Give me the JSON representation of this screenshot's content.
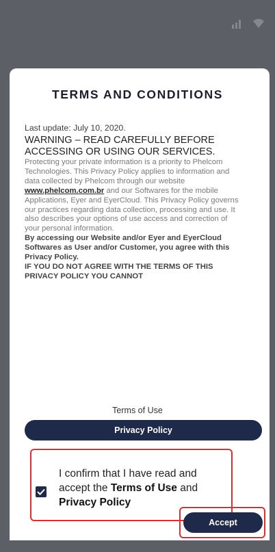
{
  "dialog": {
    "title": "TERMS AND CONDITIONS",
    "last_update": "Last update: July 10, 2020.",
    "warning": "WARNING – READ CAREFULLY BEFORE ACCESSING OR USING OUR SERVICES.",
    "body_before_link": "Protecting your private information is a priority to Phelcom Technologies. This Privacy Policy applies to information and data collected by Phelcom through our website ",
    "website_link": "www.phelcom.com.br",
    "body_after_link": " and our Softwares for the mobile Applications, Eyer and EyerCloud. This Privacy Policy governs our practices regarding data collection, processing and use. It also describes your options of use access and correction of your personal information.",
    "agreement": "By accessing our Website and/or Eyer and EyerCloud Softwares as User and/or Customer, you agree with this Privacy Policy.",
    "disagreement": "IF YOU DO NOT AGREE WITH THE TERMS OF THIS PRIVACY POLICY YOU CANNOT"
  },
  "links": {
    "terms_of_use": "Terms of Use",
    "privacy_policy": "Privacy Policy"
  },
  "confirm": {
    "checked": true,
    "text_prefix": "I confirm that I have read and accept the ",
    "terms_bold": "Terms of Use",
    "and": " and ",
    "privacy_bold": "Privacy Policy"
  },
  "actions": {
    "accept": "Accept"
  },
  "colors": {
    "backdrop": "#5c5f66",
    "primary": "#1f2a4a",
    "highlight": "#d7312f"
  }
}
